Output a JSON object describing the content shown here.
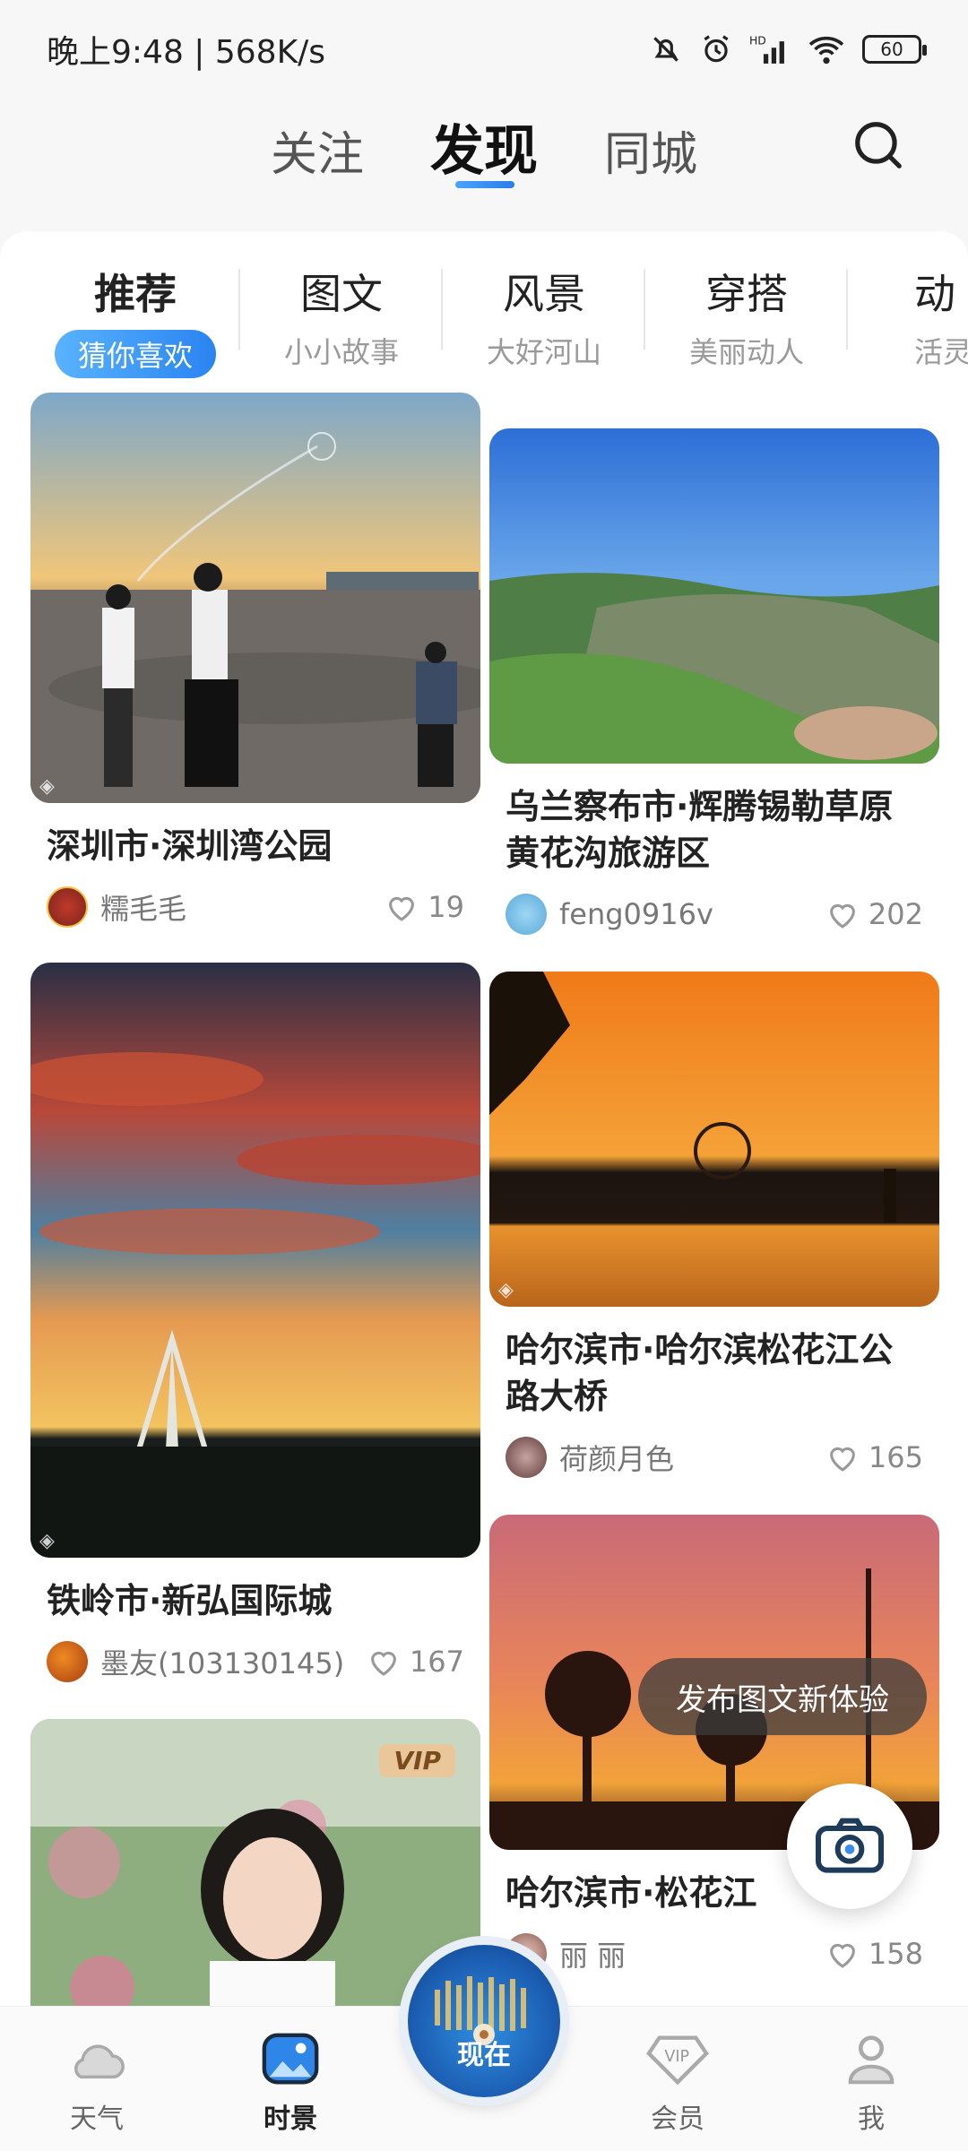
{
  "status_bar": {
    "time_speed": "晚上9:48 | 568K/s",
    "battery": "60"
  },
  "top_tabs": [
    "关注",
    "发现",
    "同城"
  ],
  "categories": [
    {
      "title": "推荐",
      "sub": "猜你喜欢"
    },
    {
      "title": "图文",
      "sub": "小小故事"
    },
    {
      "title": "风景",
      "sub": "大好河山"
    },
    {
      "title": "穿搭",
      "sub": "美丽动人"
    },
    {
      "title": "动",
      "sub": "活灵"
    }
  ],
  "feed": {
    "left": [
      {
        "title": "深圳市·深圳湾公园",
        "author": "糯毛毛",
        "likes": "19"
      },
      {
        "title": "铁岭市·新弘国际城",
        "author": "墨友(103130145)",
        "likes": "167"
      },
      {
        "title": "",
        "author": "",
        "likes": "",
        "badge": "VIP"
      }
    ],
    "right": [
      {
        "title": "乌兰察布市·辉腾锡勒草原黄花沟旅游区",
        "author": "feng0916v",
        "likes": "202"
      },
      {
        "title": "哈尔滨市·哈尔滨松花江公路大桥",
        "author": "荷颜月色",
        "likes": "165"
      },
      {
        "title": "哈尔滨市·松花江",
        "author": "丽 丽",
        "likes": "158"
      }
    ]
  },
  "toast": "发布图文新体验",
  "bottom_nav": {
    "weather": "天气",
    "scenery": "时景",
    "center": "现在",
    "vip": "会员",
    "me": "我"
  },
  "colors": {
    "accent": "#2a84f0",
    "heart": "#999999"
  }
}
